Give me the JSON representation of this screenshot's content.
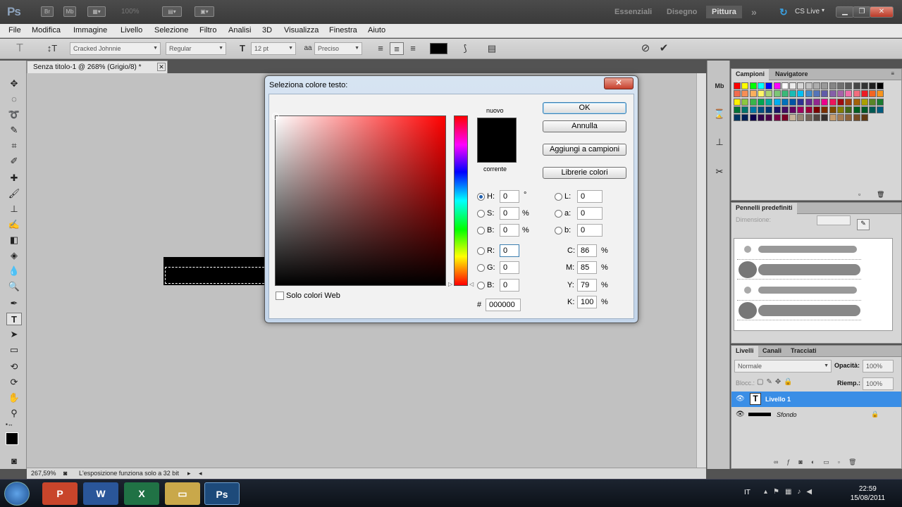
{
  "app": {
    "logo": "Ps",
    "zoom_combo": "100%",
    "workspaces": [
      "Essenziali",
      "Disegno",
      "Pittura"
    ],
    "active_workspace": "Pittura",
    "more": "»",
    "cslive": "CS Live"
  },
  "menu": [
    "File",
    "Modifica",
    "Immagine",
    "Livello",
    "Selezione",
    "Filtro",
    "Analisi",
    "3D",
    "Visualizza",
    "Finestra",
    "Aiuto"
  ],
  "options": {
    "font_family": "Cracked Johnnie",
    "font_style": "Regular",
    "font_size": "12 pt",
    "antialias": "Preciso"
  },
  "document": {
    "tab_title": "Senza titolo-1 @ 268% (Grigio/8) *",
    "zoom_status": "267,59%",
    "status_message": "L'esposizione funziona solo a 32 bit"
  },
  "dialog": {
    "title": "Seleziona colore testo:",
    "new_label": "nuovo",
    "current_label": "corrente",
    "ok": "OK",
    "cancel": "Annulla",
    "add_swatches": "Aggiungi a campioni",
    "color_libraries": "Librerie colori",
    "web_only": "Solo colori Web",
    "hsb": [
      {
        "label": "H:",
        "value": "0",
        "unit": "°"
      },
      {
        "label": "S:",
        "value": "0",
        "unit": "%"
      },
      {
        "label": "B:",
        "value": "0",
        "unit": "%"
      }
    ],
    "lab": [
      {
        "label": "L:",
        "value": "0"
      },
      {
        "label": "a:",
        "value": "0"
      },
      {
        "label": "b:",
        "value": "0"
      }
    ],
    "rgb": [
      {
        "label": "R:",
        "value": "0"
      },
      {
        "label": "G:",
        "value": "0"
      },
      {
        "label": "B:",
        "value": "0"
      }
    ],
    "cmyk": [
      {
        "label": "C:",
        "value": "86",
        "unit": "%"
      },
      {
        "label": "M:",
        "value": "85",
        "unit": "%"
      },
      {
        "label": "Y:",
        "value": "79",
        "unit": "%"
      },
      {
        "label": "K:",
        "value": "100",
        "unit": "%"
      }
    ],
    "hex_label": "#",
    "hex": "000000"
  },
  "panels": {
    "swatches_tab": "Campioni",
    "navigator_tab": "Navigatore",
    "brushes_title": "Pennelli predefiniti",
    "brushes_size": "Dimensione:",
    "layers_tabs": [
      "Livelli",
      "Canali",
      "Tracciati"
    ],
    "blend_mode": "Normale",
    "opacity_label": "Opacità:",
    "opacity": "100%",
    "lock_label": "Blocc.:",
    "fill_label": "Riemp.:",
    "fill": "100%",
    "layers": [
      {
        "name": "Livello 1",
        "selected": true
      },
      {
        "name": "Sfondo",
        "selected": false
      }
    ]
  },
  "taskbar": {
    "lang": "IT",
    "time": "22:59",
    "date": "15/08/2011",
    "apps": [
      "PowerPoint",
      "W",
      "X",
      "Explorer",
      "Ps"
    ]
  },
  "colors": {
    "accent": "#3a8ee6",
    "swatch_palette": [
      "#ff0000",
      "#ffff00",
      "#00ff00",
      "#00ffff",
      "#0000ff",
      "#ff00ff",
      "#ffffff",
      "#ebebeb",
      "#d6d6d6",
      "#c2c2c2",
      "#adadad",
      "#999999",
      "#858585",
      "#707070",
      "#5c5c5c",
      "#474747",
      "#333333",
      "#1f1f1f",
      "#000000",
      "#f26c4f",
      "#f68e56",
      "#fbaf5d",
      "#fff568",
      "#acd372",
      "#7cc576",
      "#3bb878",
      "#1abbb4",
      "#00bff3",
      "#438cca",
      "#5574b9",
      "#605ca8",
      "#855fa8",
      "#a763a8",
      "#f06ea9",
      "#f26d7d",
      "#ed1c24",
      "#f26522",
      "#f7941d",
      "#fff200",
      "#8dc73f",
      "#39b54a",
      "#00a651",
      "#00a99d",
      "#00aeef",
      "#0072bc",
      "#0054a6",
      "#2e3192",
      "#662d91",
      "#92278f",
      "#ec008c",
      "#ed145b",
      "#9e0b0f",
      "#a0410d",
      "#a36209",
      "#aba000",
      "#598527",
      "#1a7b30",
      "#007236",
      "#00746b",
      "#0076a3",
      "#004b80",
      "#003471",
      "#1b1464",
      "#440e62",
      "#630460",
      "#9e005d",
      "#9e0039",
      "#790000",
      "#7b2e00",
      "#7d4900",
      "#827b00",
      "#406618",
      "#005e20",
      "#005826",
      "#005952",
      "#005b7f",
      "#003663",
      "#002157",
      "#0d004c",
      "#32004b",
      "#4b0049",
      "#7b0046",
      "#7a0026",
      "#c7b299",
      "#998675",
      "#736357",
      "#534741",
      "#362f2d",
      "#c69c6d",
      "#a67c52",
      "#8c6239",
      "#754c24",
      "#603913"
    ]
  }
}
